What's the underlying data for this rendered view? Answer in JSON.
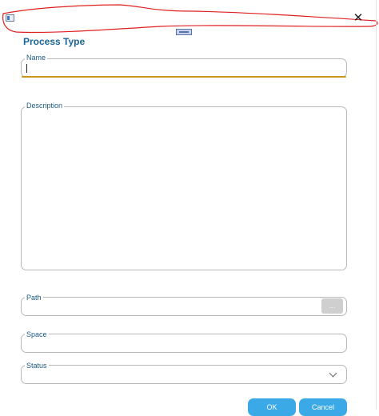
{
  "dialog": {
    "title": "Process Type",
    "close_glyph": "✕",
    "app_icon": "window-app-icon",
    "accent_color": "#3aa9e6",
    "title_color": "#1a6496"
  },
  "fields": {
    "name": {
      "label": "Name",
      "value": ""
    },
    "description": {
      "label": "Description",
      "value": ""
    },
    "path": {
      "label": "Path",
      "value": "",
      "browse_label": "..."
    },
    "space": {
      "label": "Space",
      "value": ""
    },
    "status": {
      "label": "Status",
      "value": ""
    }
  },
  "buttons": {
    "ok": "OK",
    "cancel": "Cancel"
  }
}
